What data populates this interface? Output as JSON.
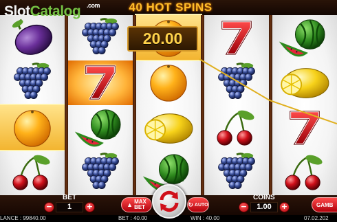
{
  "header": {
    "logo_slot": "Slot",
    "logo_catalog": "Catalog",
    "logo_com": ".com",
    "title": "40 HOT SPINS"
  },
  "reels": [
    [
      "plum",
      "grapes",
      "orange",
      "cherries"
    ],
    [
      "grapes",
      "seven",
      "watermelon",
      "grapes"
    ],
    [
      "orange",
      "orange",
      "lemon",
      "watermelon"
    ],
    [
      "seven",
      "grapes",
      "cherries",
      "grapes"
    ],
    [
      "watermelon",
      "lemon",
      "seven",
      "cherries"
    ]
  ],
  "highlighted_cells": [
    [
      0,
      2
    ],
    [
      1,
      1
    ],
    [
      2,
      0
    ]
  ],
  "win_amount": "20.00",
  "controls": {
    "bet_label": "BET",
    "bet_value": "1",
    "max_bet_label_1": "MAX",
    "max_bet_label_2": "BET",
    "auto_label": "AUTO",
    "coins_label": "COINS",
    "coins_value": "1.00",
    "gamble_label": "GAMB",
    "minus": "−",
    "plus": "+"
  },
  "status": {
    "balance": "LANCE : 99840.00",
    "bet": "BET : 40.00",
    "win": "WIN : 40.00",
    "time": "07.02.202"
  },
  "colors": {
    "title": "#ffbe2a",
    "win_text": "#ffd24a",
    "button_red": "#d0101a",
    "payline": "#e0b020"
  }
}
